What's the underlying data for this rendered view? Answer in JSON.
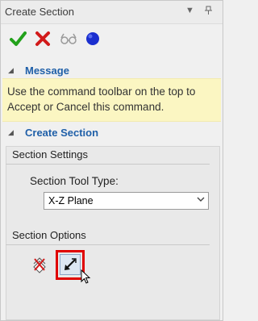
{
  "panel": {
    "title": "Create Section",
    "pin_icon": "pin-icon",
    "dropdown_icon": "dropdown-icon"
  },
  "toolbar": {
    "buttons": [
      {
        "name": "accept",
        "icon": "green-check-icon",
        "color": "#22a11b"
      },
      {
        "name": "cancel",
        "icon": "red-x-icon",
        "color": "#d21a1a"
      },
      {
        "name": "preview",
        "icon": "glasses-icon",
        "color": "#9a9a9a"
      },
      {
        "name": "apply",
        "icon": "blue-circle-icon",
        "color": "#1b2fcf"
      }
    ]
  },
  "message_section": {
    "header": "Message",
    "text_line1": "Use the command toolbar on the top to",
    "text_line2": "Accept or Cancel this command."
  },
  "create_section": {
    "header": "Create Section",
    "settings_title": "Section Settings",
    "tool_type_label": "Section Tool Type:",
    "tool_type_value": "X-Z Plane",
    "options_title": "Section Options",
    "option_buttons": [
      {
        "name": "disable-section",
        "icon": "section-off-icon"
      },
      {
        "name": "flip-direction",
        "icon": "flip-arrow-icon",
        "highlighted": true
      }
    ]
  },
  "colors": {
    "accent": "#1f5fa8",
    "message_bg": "#fbf6c2",
    "highlight": "#e00000"
  }
}
